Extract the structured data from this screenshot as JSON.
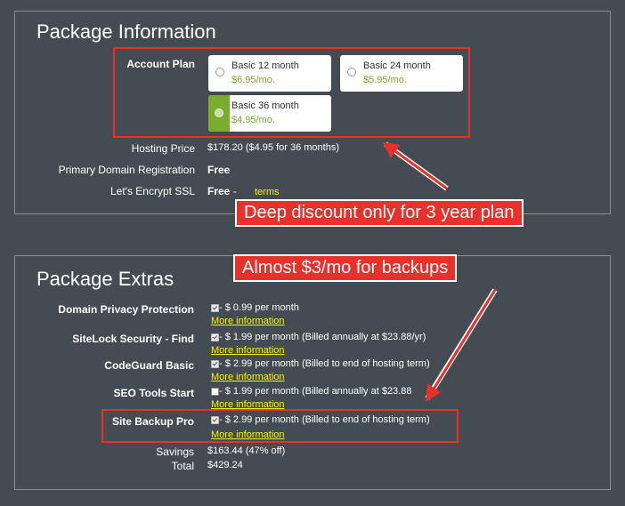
{
  "package_info": {
    "title": "Package Information",
    "account_plan_label": "Account Plan",
    "plans": [
      {
        "name": "Basic 12 month",
        "price": "$6.95/mo.",
        "selected": false
      },
      {
        "name": "Basic 24 month",
        "price": "$5.95/mo.",
        "selected": false
      },
      {
        "name": "Basic 36 month",
        "price": "$4.95/mo.",
        "selected": true
      }
    ],
    "hosting_price_label": "Hosting Price",
    "hosting_price_value": "$178.20  ($4.95 for 36 months)",
    "domain_label": "Primary Domain Registration",
    "domain_value": "Free",
    "ssl_label": "Let's Encrypt SSL",
    "ssl_value": "Free",
    "ssl_sep": " - ",
    "ssl_terms": "terms"
  },
  "package_extras": {
    "title": "Package Extras",
    "items": [
      {
        "label": "Domain Privacy Protection",
        "checked": true,
        "desc": " - $ 0.99 per month",
        "more": "More information"
      },
      {
        "label": "SiteLock Security - Find",
        "checked": true,
        "desc": " - $ 1.99 per month (Billed annually at $23.88/yr)",
        "more": "More information"
      },
      {
        "label": "CodeGuard Basic",
        "checked": true,
        "desc": " - $ 2.99 per month (Billed to end of hosting term)",
        "more": "More information"
      },
      {
        "label": "SEO Tools Start",
        "checked": false,
        "desc": " - $ 1.99 per month (Billed annually at $23.88",
        "more": "More information"
      },
      {
        "label": "Site Backup Pro",
        "checked": true,
        "desc": " - $ 2.99 per month (Billed to end of hosting term)",
        "more": "More information"
      }
    ],
    "savings_label": "Savings",
    "savings_value": "$163.44 (47% off)",
    "total_label": "Total",
    "total_value": "$429.24"
  },
  "annotations": {
    "callout_discount": "Deep discount only for 3 year plan",
    "callout_backups": "Almost $3/mo for backups",
    "accent_color": "#e8312b"
  },
  "colors": {
    "background": "#454b52",
    "link_yellow": "#f6f400",
    "plan_green": "#7aac2f"
  }
}
